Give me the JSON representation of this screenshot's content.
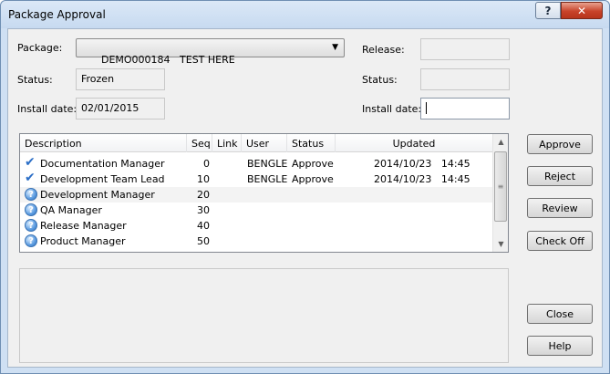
{
  "window": {
    "title": "Package Approval",
    "help_glyph": "?",
    "close_glyph": "✕"
  },
  "package": {
    "label": "Package:",
    "value": "DEMO000184   TEST HERE",
    "arrow": "▼"
  },
  "left": {
    "status_label": "Status:",
    "status_value": "Frozen",
    "install_label": "Install date:",
    "install_value": "02/01/2015"
  },
  "right": {
    "release_label": "Release:",
    "release_value": "",
    "status_label": "Status:",
    "status_value": "",
    "install_label": "Install date:",
    "install_value": ""
  },
  "table": {
    "headers": [
      "Description",
      "Seq",
      "Link",
      "User",
      "Status",
      "Updated"
    ],
    "rows": [
      {
        "icon": "check",
        "glyph": "✔",
        "description": "Documentation Manager",
        "seq": "0",
        "link": "",
        "user": "BENGLE",
        "status": "Approve",
        "updated": "2014/10/23   14:45"
      },
      {
        "icon": "check",
        "glyph": "✔",
        "description": "Development Team Lead",
        "seq": "10",
        "link": "",
        "user": "BENGLE",
        "status": "Approve",
        "updated": "2014/10/23   14:45"
      },
      {
        "icon": "question",
        "glyph": "?",
        "description": "Development Manager",
        "seq": "20",
        "link": "",
        "user": "",
        "status": "",
        "updated": ""
      },
      {
        "icon": "question",
        "glyph": "?",
        "description": "QA Manager",
        "seq": "30",
        "link": "",
        "user": "",
        "status": "",
        "updated": ""
      },
      {
        "icon": "question",
        "glyph": "?",
        "description": "Release Manager",
        "seq": "40",
        "link": "",
        "user": "",
        "status": "",
        "updated": ""
      },
      {
        "icon": "question",
        "glyph": "?",
        "description": "Product Manager",
        "seq": "50",
        "link": "",
        "user": "",
        "status": "",
        "updated": ""
      }
    ],
    "scroll_up": "▲",
    "scroll_down": "▼",
    "scroll_grip": "≡"
  },
  "buttons": {
    "approve": "Approve",
    "reject": "Reject",
    "review": "Review",
    "check_off": "Check Off",
    "close": "Close",
    "help": "Help"
  }
}
